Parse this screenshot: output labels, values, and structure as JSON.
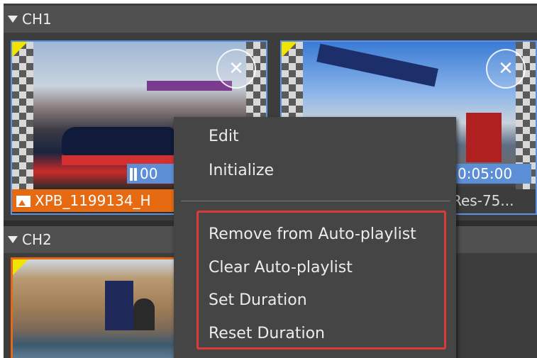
{
  "channels": [
    {
      "name": "CH1"
    },
    {
      "name": "CH2"
    }
  ],
  "ch1_tiles": [
    {
      "time": "00",
      "label": "XPB_1199134_H"
    },
    {
      "time": "0:05:00",
      "label": "Res-75..."
    }
  ],
  "context_menu": {
    "items": [
      "Edit",
      "Initialize",
      "Remove from Auto-playlist",
      "Clear Auto-playlist",
      "Set Duration",
      "Reset Duration"
    ]
  },
  "icons": {
    "close": "close-icon",
    "pause": "pause-icon",
    "image": "image-icon",
    "expand": "triangle-down-icon"
  },
  "colors": {
    "selection_border": "#5b94e6",
    "active_border": "#e56a12",
    "highlight_box": "#dd3a3a",
    "corner_marker": "#f2e400",
    "time_badge": "#5d8fd6"
  }
}
